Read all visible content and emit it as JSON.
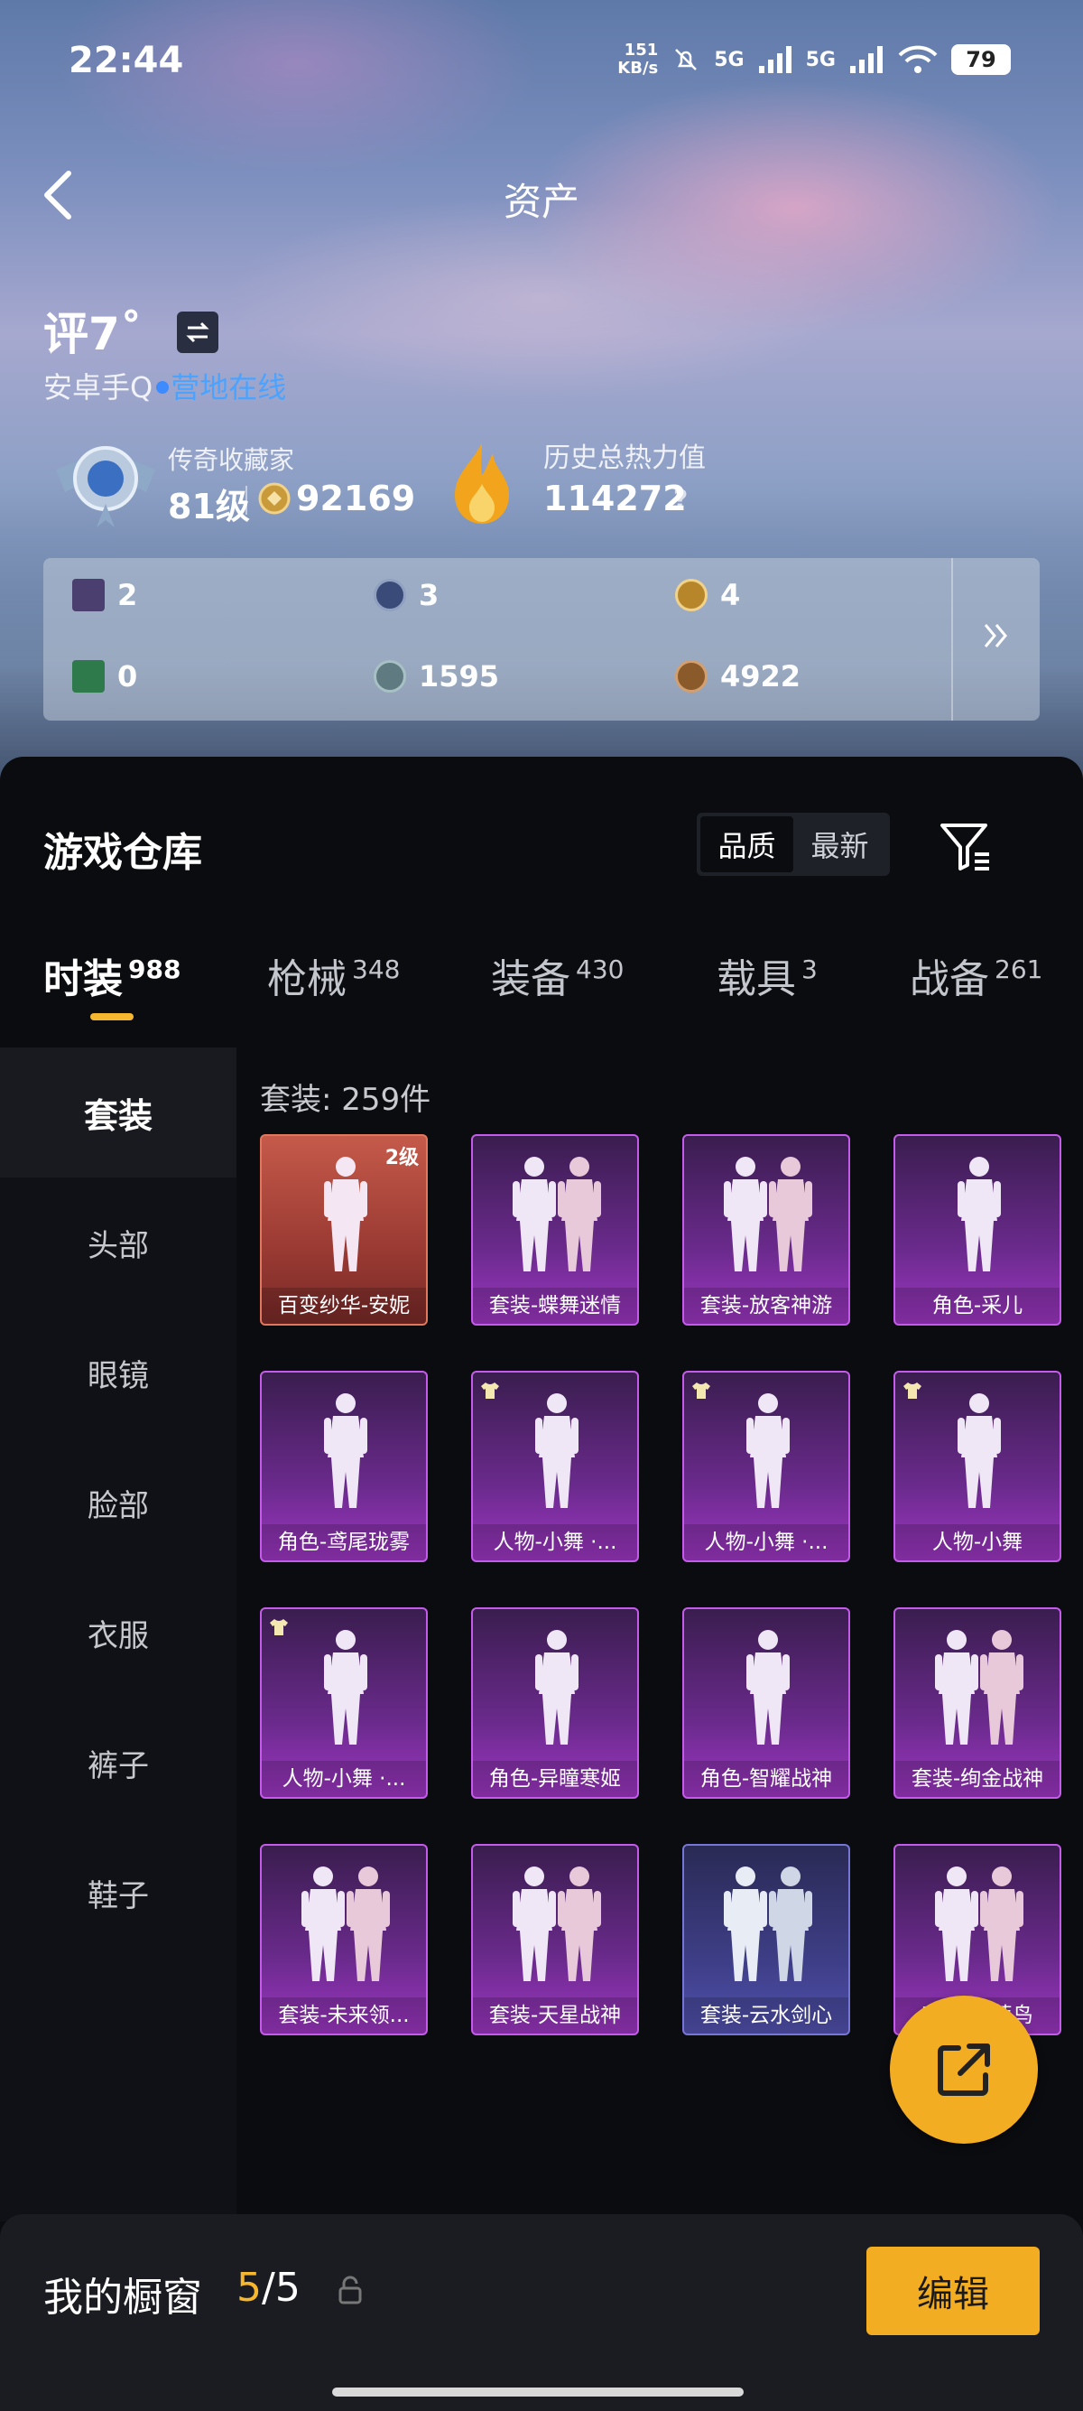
{
  "status_bar": {
    "time": "22:44",
    "net_speed_value": "151",
    "net_speed_unit": "KB/s",
    "signal1": "5G",
    "signal2": "5G",
    "battery": "79"
  },
  "header": {
    "title": "资产"
  },
  "profile": {
    "name": "评7˚",
    "platform": "安卓手Q",
    "online_status": "营地在线"
  },
  "collector": {
    "label": "传奇收藏家",
    "level": "81级",
    "points": "92169"
  },
  "heat": {
    "label": "历史总热力值",
    "value": "114272",
    "help": "?"
  },
  "resources": [
    {
      "icon": "card-icon",
      "value": "2",
      "color": "#4a3f6e"
    },
    {
      "icon": "blue-token-icon",
      "value": "3",
      "color": "#3a4b7a"
    },
    {
      "icon": "gold-token-icon",
      "value": "4",
      "color": "#b8862a"
    },
    {
      "icon": "green-card-icon",
      "value": "0",
      "color": "#2f7a4a"
    },
    {
      "icon": "silver-coin-icon",
      "value": "1595",
      "color": "#5f7a80"
    },
    {
      "icon": "bronze-coin-icon",
      "value": "4922",
      "color": "#8a5a2a"
    }
  ],
  "warehouse": {
    "title": "游戏仓库",
    "sort_options": [
      "品质",
      "最新"
    ],
    "tabs": [
      {
        "label": "时装",
        "count": "988"
      },
      {
        "label": "枪械",
        "count": "348"
      },
      {
        "label": "装备",
        "count": "430"
      },
      {
        "label": "载具",
        "count": "3"
      },
      {
        "label": "战备",
        "count": "261"
      }
    ],
    "categories": [
      "套装",
      "头部",
      "眼镜",
      "脸部",
      "衣服",
      "裤子",
      "鞋子"
    ],
    "set_count": "套装: 259件",
    "items": [
      {
        "label": "百变纱华-安妮",
        "rarity": "red",
        "level": "2级"
      },
      {
        "label": "套装-蝶舞迷情",
        "rarity": "purple"
      },
      {
        "label": "套装-放客神游",
        "rarity": "purple"
      },
      {
        "label": "角色-采儿",
        "rarity": "purple"
      },
      {
        "label": "角色-鸢尾珑雾",
        "rarity": "purple"
      },
      {
        "label": "人物-小舞 ·...",
        "rarity": "purple"
      },
      {
        "label": "人物-小舞 ·...",
        "rarity": "purple"
      },
      {
        "label": "人物-小舞",
        "rarity": "purple"
      },
      {
        "label": "人物-小舞 ·...",
        "rarity": "purple"
      },
      {
        "label": "角色-异瞳寒姬",
        "rarity": "purple"
      },
      {
        "label": "角色-智耀战神",
        "rarity": "purple"
      },
      {
        "label": "套装-绚金战神",
        "rarity": "purple"
      },
      {
        "label": "套装-未来领...",
        "rarity": "purple"
      },
      {
        "label": "套装-天星战神",
        "rarity": "purple"
      },
      {
        "label": "套装-云水剑心",
        "rarity": "blue"
      },
      {
        "label": "套装-糖蒜鸟",
        "rarity": "purple"
      },
      {
        "label": "",
        "rarity": "blue"
      },
      {
        "label": "",
        "rarity": "blue"
      },
      {
        "label": "",
        "rarity": "blue"
      },
      {
        "label": "",
        "rarity": "blue"
      }
    ]
  },
  "showcase": {
    "label": "我的橱窗",
    "current": "5",
    "total": "5",
    "edit_label": "编辑"
  },
  "colors": {
    "accent": "#f3ad22",
    "online": "#4aa3ff"
  }
}
